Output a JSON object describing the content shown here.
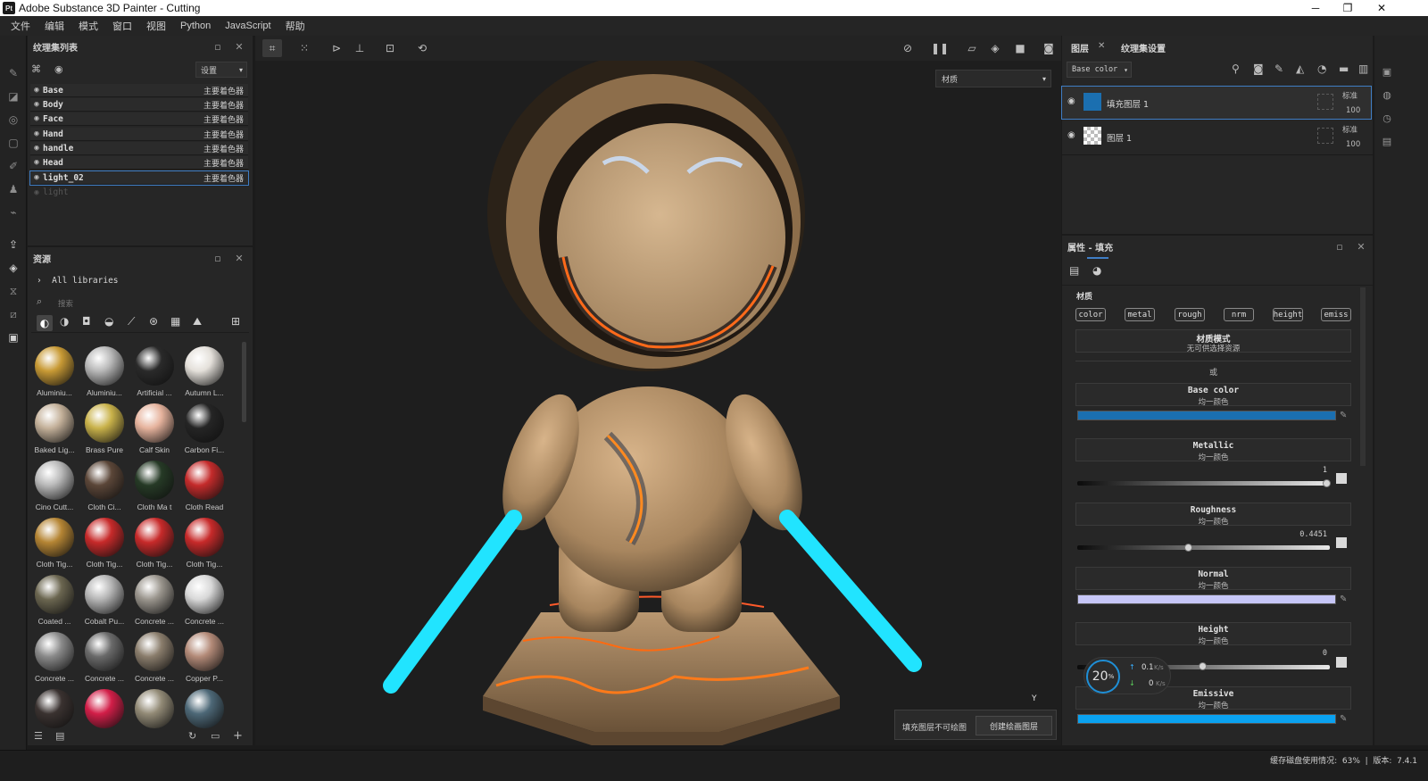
{
  "window": {
    "logo": "Pt",
    "title": "Adobe Substance 3D Painter - Cutting"
  },
  "menu": [
    "文件",
    "编辑",
    "模式",
    "窗口",
    "视图",
    "Python",
    "JavaScript",
    "帮助"
  ],
  "texture_set_list": {
    "title": "纹理集列表",
    "settings_label": "设置",
    "items": [
      {
        "name": "Base",
        "shader": "主要着色器"
      },
      {
        "name": "Body",
        "shader": "主要着色器"
      },
      {
        "name": "Face",
        "shader": "主要着色器"
      },
      {
        "name": "Hand",
        "shader": "主要着色器"
      },
      {
        "name": "handle",
        "shader": "主要着色器"
      },
      {
        "name": "Head",
        "shader": "主要着色器"
      },
      {
        "name": "light_02",
        "shader": "主要着色器"
      },
      {
        "name": "light",
        "shader": ""
      }
    ]
  },
  "assets": {
    "title": "资源",
    "library": "All libraries",
    "search_placeholder": "搜索",
    "items": [
      {
        "label": "Aluminiu...",
        "color": "#c89a35"
      },
      {
        "label": "Aluminiu...",
        "color": "#b8b8b8"
      },
      {
        "label": "Artificial ...",
        "color": "#2a2a2a"
      },
      {
        "label": "Autumn L...",
        "color": "#e4e0da"
      },
      {
        "label": "Baked Lig...",
        "color": "#c4b19a"
      },
      {
        "label": "Brass Pure",
        "color": "#c9b24a"
      },
      {
        "label": "Calf Skin",
        "color": "#e6b39d"
      },
      {
        "label": "Carbon Fi...",
        "color": "#252525"
      },
      {
        "label": "Cino Cutt...",
        "color": "#b9b9b9"
      },
      {
        "label": "Cloth Ci...",
        "color": "#5b4638"
      },
      {
        "label": "Cloth Ma t",
        "color": "#263a26"
      },
      {
        "label": "Cloth Read",
        "color": "#c42b2b"
      },
      {
        "label": "Cloth Tig...",
        "color": "#b58534"
      },
      {
        "label": "Cloth Tig...",
        "color": "#c72a2a"
      },
      {
        "label": "Cloth Tig...",
        "color": "#c72a2a"
      },
      {
        "label": "Cloth Tig...",
        "color": "#c72a2a"
      },
      {
        "label": "Coated ...",
        "color": "#6b6650"
      },
      {
        "label": "Cobalt Pu...",
        "color": "#b5b5b5"
      },
      {
        "label": "Concrete ...",
        "color": "#9a958d"
      },
      {
        "label": "Concrete ...",
        "color": "#d8d8d8"
      },
      {
        "label": "Concrete ...",
        "color": "#8a8a8a"
      },
      {
        "label": "Concrete ...",
        "color": "#6a6a6a"
      },
      {
        "label": "Concrete ...",
        "color": "#8a7d6c"
      },
      {
        "label": "Copper P...",
        "color": "#b38a78"
      },
      {
        "label": "",
        "color": "#3a3230"
      },
      {
        "label": "",
        "color": "#d21e48"
      },
      {
        "label": "",
        "color": "#928a76"
      },
      {
        "label": "",
        "color": "#4d6877"
      }
    ]
  },
  "viewport": {
    "view_mode": "材质",
    "axis_label": "Y",
    "notice_text": "填充图层不可绘图",
    "notice_button": "创建绘画图层"
  },
  "layers": {
    "tab_layers": "图层",
    "tab_settings": "纹理集设置",
    "channel": "Base color",
    "items": [
      {
        "name": "填充图层 1",
        "blend": "标准",
        "opacity": "100"
      },
      {
        "name": "图层 1",
        "blend": "标准",
        "opacity": "100"
      }
    ]
  },
  "properties": {
    "title": "属性 - 填充",
    "section_material": "材质",
    "channels": [
      "color",
      "metal",
      "rough",
      "nrm",
      "height",
      "emiss"
    ],
    "material_mode_title": "材质模式",
    "material_mode_sub": "无可供选择资源",
    "or_label": "或",
    "uniform_label": "均一颜色",
    "base_color_label": "Base color",
    "base_color": "#1b6fb0",
    "metallic_label": "Metallic",
    "metallic_value": "1",
    "roughness_label": "Roughness",
    "roughness_value": "0.4451",
    "normal_label": "Normal",
    "normal_color": "#c6c6f7",
    "height_label": "Height",
    "height_value": "0",
    "emissive_label": "Emissive",
    "emissive_color": "#0aa2f0"
  },
  "network_widget": {
    "percent": "20",
    "percent_unit": "%",
    "upload": "0.1",
    "download": "0",
    "unit": "K/s"
  },
  "status_bar": {
    "text": "缓存磁盘使用情况:  63%  |  版本:  7.4.1"
  }
}
